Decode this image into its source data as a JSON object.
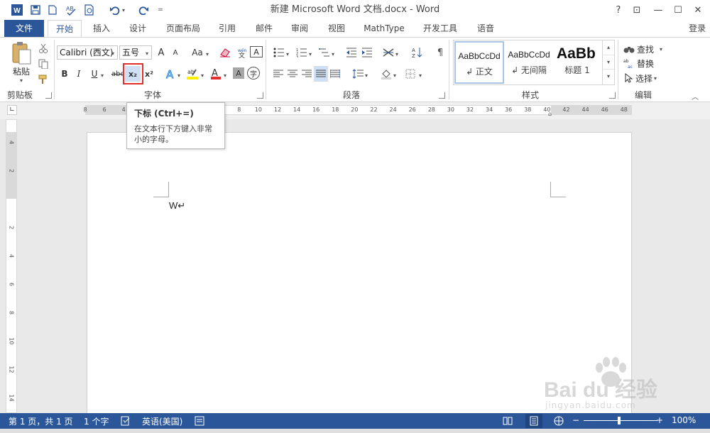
{
  "window": {
    "title": "新建 Microsoft Word 文档.docx - Word",
    "help": "?",
    "ribbon_display": "⊡",
    "minimize": "—",
    "maximize": "☐",
    "close": "✕"
  },
  "tabs": {
    "file": "文件",
    "home": "开始",
    "insert": "插入",
    "design": "设计",
    "layout": "页面布局",
    "references": "引用",
    "mailings": "邮件",
    "review": "审阅",
    "view": "视图",
    "mathtype": "MathType",
    "developer": "开发工具",
    "language": "语音",
    "login": "登录"
  },
  "ribbon": {
    "clipboard": {
      "label": "剪贴板",
      "paste": "粘贴"
    },
    "font": {
      "label": "字体",
      "font_name": "Calibri (西文)",
      "font_size": "五号",
      "bold": "B",
      "italic": "I",
      "underline": "U",
      "strike": "abc",
      "subscript": "x₂",
      "superscript": "x²",
      "change_case": "Aa",
      "grow": "A",
      "shrink": "A",
      "char_border": "A",
      "char_shading": "A",
      "enclose": "字"
    },
    "paragraph": {
      "label": "段落"
    },
    "styles": {
      "label": "样式",
      "items": [
        {
          "preview": "AaBbCcDd",
          "name": "↲ 正文"
        },
        {
          "preview": "AaBbCcDd",
          "name": "↲ 无间隔"
        },
        {
          "preview": "AaBb",
          "name": "标题 1"
        }
      ]
    },
    "editing": {
      "label": "编辑",
      "find": "查找",
      "replace": "替换",
      "select": "选择"
    }
  },
  "ruler": {
    "h_ticks": [
      "8",
      "6",
      "4",
      "2",
      "",
      "2",
      "4",
      "6",
      "8",
      "10",
      "12",
      "14",
      "16",
      "18",
      "20",
      "22",
      "24",
      "26",
      "28",
      "30",
      "32",
      "34",
      "36",
      "38",
      "40",
      "42",
      "44",
      "46",
      "48"
    ],
    "v_ticks": [
      "4",
      "2",
      "",
      "2",
      "4",
      "6",
      "8",
      "10",
      "12",
      "14"
    ]
  },
  "tooltip": {
    "title": "下标 (Ctrl+=)",
    "body": "在文本行下方键入非常小的字母。"
  },
  "document": {
    "text": "W↵"
  },
  "status": {
    "page": "第 1 页，共 1 页",
    "words": "1 个字",
    "language": "英语(美国)",
    "zoom": "100%"
  },
  "watermark": {
    "brand": "Bai du 经验",
    "url": "jingyan.baidu.com"
  },
  "colors": {
    "accent": "#2b579a",
    "highlight_box": "#e3302f"
  }
}
